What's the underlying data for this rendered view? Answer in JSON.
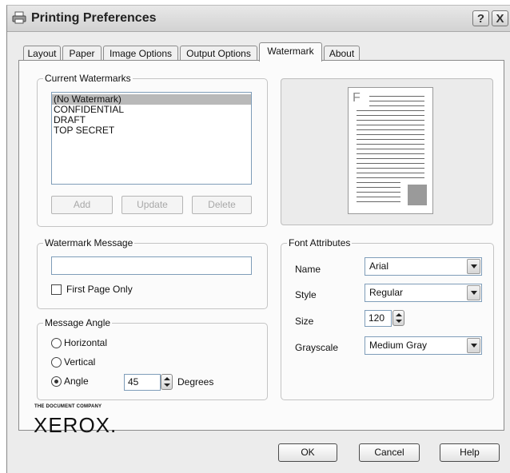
{
  "window": {
    "title": "Printing Preferences",
    "help_btn": "?",
    "close_btn": "X"
  },
  "tabs": [
    "Layout",
    "Paper",
    "Image Options",
    "Output Options",
    "Watermark",
    "About"
  ],
  "active_tab": "Watermark",
  "current_watermarks": {
    "legend": "Current Watermarks",
    "items": [
      "(No Watermark)",
      "CONFIDENTIAL",
      "DRAFT",
      "TOP SECRET"
    ],
    "selected": "(No Watermark)",
    "add_label": "Add",
    "update_label": "Update",
    "delete_label": "Delete"
  },
  "preview": {
    "letter": "F"
  },
  "watermark_message": {
    "legend": "Watermark Message",
    "value": "",
    "first_page_only_label": "First Page Only",
    "first_page_only_checked": false
  },
  "message_angle": {
    "legend": "Message Angle",
    "horizontal_label": "Horizontal",
    "vertical_label": "Vertical",
    "angle_label": "Angle",
    "selected": "Angle",
    "angle_value": "45",
    "degrees_label": "Degrees"
  },
  "font_attributes": {
    "legend": "Font Attributes",
    "name_label": "Name",
    "name_value": "Arial",
    "style_label": "Style",
    "style_value": "Regular",
    "size_label": "Size",
    "size_value": "120",
    "grayscale_label": "Grayscale",
    "grayscale_value": "Medium Gray"
  },
  "logo": {
    "tagline": "THE DOCUMENT COMPANY",
    "brand": "XEROX."
  },
  "footer": {
    "ok_label": "OK",
    "cancel_label": "Cancel",
    "help_label": "Help"
  }
}
